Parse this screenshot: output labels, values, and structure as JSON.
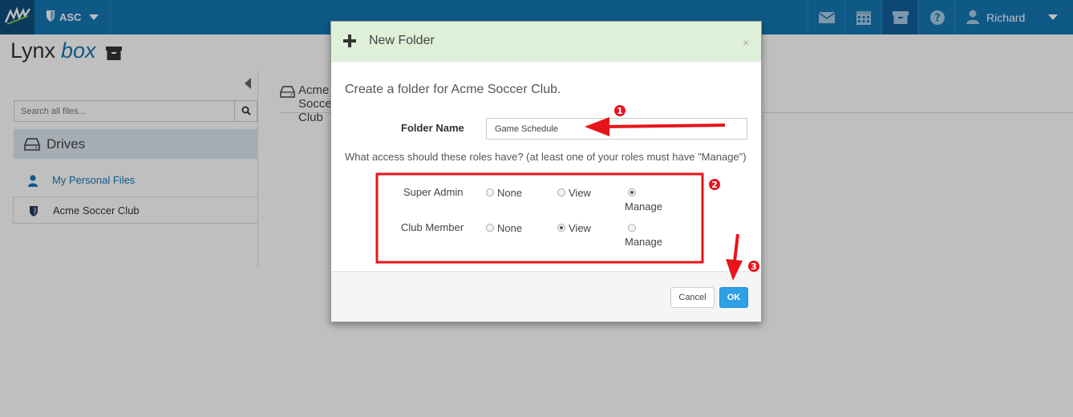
{
  "topbar": {
    "org_short": "ASC",
    "user_name": "Richard",
    "nav_icons": [
      "envelope-icon",
      "calendar-icon",
      "archive-icon",
      "help-icon"
    ]
  },
  "brand": {
    "part1": "Lynx",
    "part2": "box"
  },
  "sidebar": {
    "search_placeholder": "Search all files...",
    "drives_label": "Drives",
    "items": [
      {
        "label": "My Personal Files",
        "icon": "user-icon"
      },
      {
        "label": "Acme Soccer Club",
        "icon": "shield-icon"
      }
    ]
  },
  "content": {
    "heading": "Acme Soccer Club"
  },
  "modal": {
    "title": "New Folder",
    "close_label": "×",
    "subtitle": "Create a folder for Acme Soccer Club.",
    "folder_name_label": "Folder Name",
    "folder_name_value": "Game Schedule",
    "access_question": "What access should these roles have? (at least one of your roles must have \"Manage\")",
    "options": {
      "none": "None",
      "view": "View",
      "manage": "Manage"
    },
    "roles": [
      {
        "name": "Super Admin",
        "selected": "manage"
      },
      {
        "name": "Club Member",
        "selected": "view"
      }
    ],
    "cancel_label": "Cancel",
    "ok_label": "OK"
  },
  "annotations": {
    "steps": [
      "1",
      "2",
      "3"
    ],
    "color": "#e8141c"
  },
  "colors": {
    "topbar": "#1577b5",
    "header_green": "#dff0d8",
    "ok_button": "#2ea0e6"
  }
}
